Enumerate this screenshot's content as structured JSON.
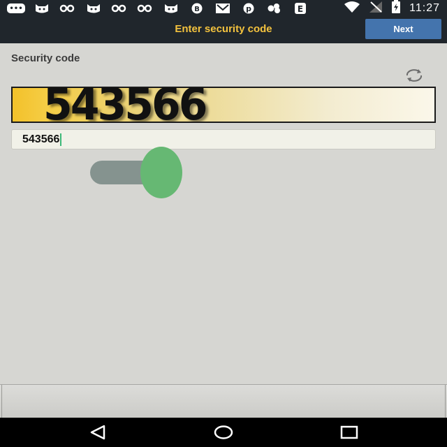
{
  "status_bar": {
    "time": "11:27",
    "notification_icons": [
      "chat-icon",
      "cat-icon",
      "link-icon",
      "cat-icon",
      "link-icon",
      "link-icon",
      "cat-icon",
      "whatsapp-icon",
      "email-icon",
      "pinterest-icon",
      "cluster-icon",
      "app-icon"
    ],
    "system_icons": [
      "wifi-icon",
      "no-signal-icon",
      "battery-charging-icon"
    ]
  },
  "header": {
    "title": "Enter security code",
    "next_label": "Next",
    "title_color": "#f3c23e",
    "button_color": "#4474ad"
  },
  "content": {
    "section_label": "Security code",
    "captcha_text": "543566",
    "input_value": "543566"
  },
  "toggle": {
    "state": "on",
    "thumb_color": "#66b873"
  },
  "nav_bar": {
    "buttons": [
      "back-icon",
      "home-icon",
      "recents-icon"
    ]
  }
}
